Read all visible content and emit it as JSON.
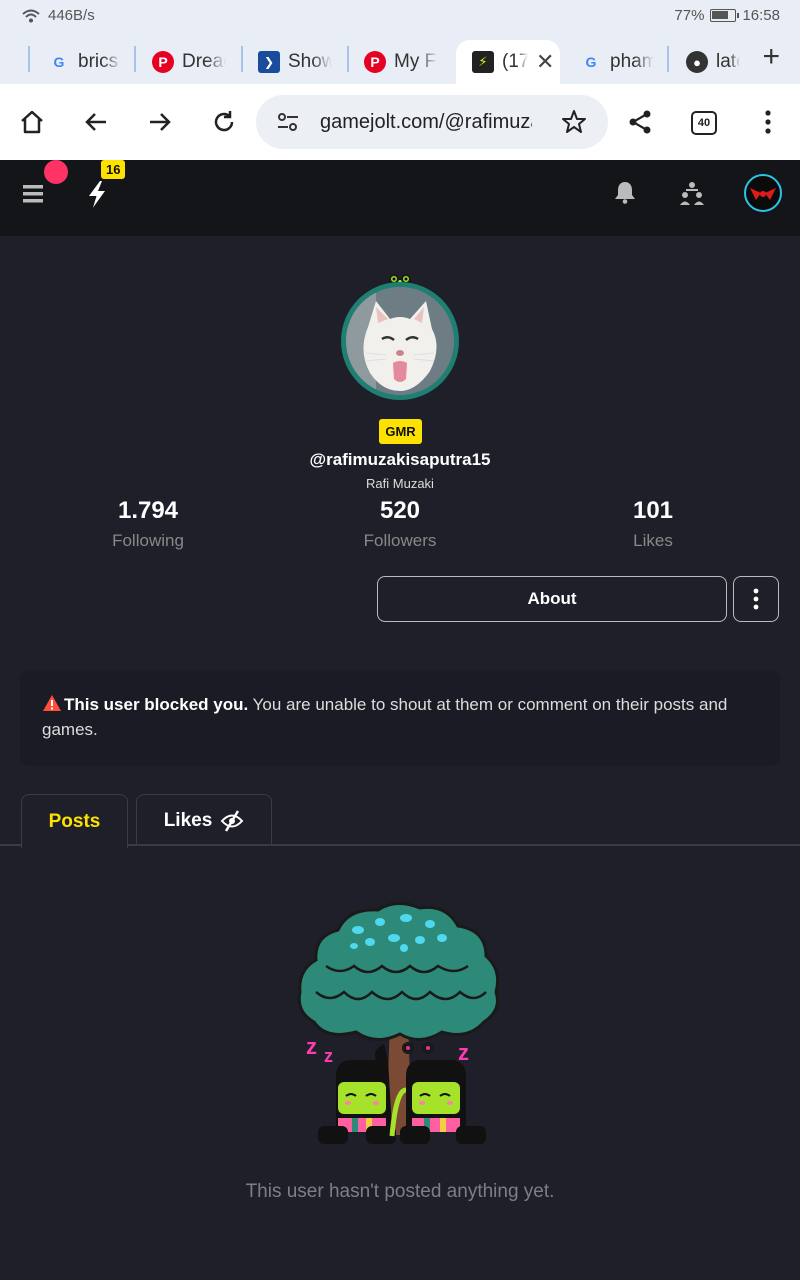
{
  "status_bar": {
    "speed": "446B/s",
    "battery": "77%",
    "time": "16:58"
  },
  "browser": {
    "tabs": [
      {
        "title": "brics",
        "favicon": "google-icon",
        "active": false
      },
      {
        "title": "Dreac",
        "favicon": "pinterest-icon",
        "active": false
      },
      {
        "title": "Show",
        "favicon": "app-icon",
        "active": false
      },
      {
        "title": "My Fe",
        "favicon": "pinterest-icon",
        "active": false
      },
      {
        "title": "(17",
        "favicon": "gamejolt-icon",
        "active": true
      },
      {
        "title": "pham",
        "favicon": "google-icon",
        "active": false
      },
      {
        "title": "late",
        "favicon": "globe-icon",
        "active": false
      }
    ],
    "url": "gamejolt.com/@rafimuzakisaputra15",
    "tab_count": "40"
  },
  "app_header": {
    "notification_count": "16"
  },
  "profile": {
    "badge": "GMR",
    "username": "@rafimuzakisaputra15",
    "display_name": "Rafi Muzaki",
    "stats": [
      {
        "value": "1.794",
        "label": "Following"
      },
      {
        "value": "520",
        "label": "Followers"
      },
      {
        "value": "101",
        "label": "Likes"
      }
    ],
    "about_label": "About"
  },
  "blocked_notice": {
    "bold": "This user blocked you.",
    "text": " You are unable to shout at them or comment on their posts and games."
  },
  "content_tabs": {
    "posts": "Posts",
    "likes": "Likes"
  },
  "empty_state": "This user hasn't posted anything yet.",
  "colors": {
    "accent": "#fde200",
    "background": "#1e1f29",
    "header": "#141519",
    "alert": "#ff3366"
  }
}
